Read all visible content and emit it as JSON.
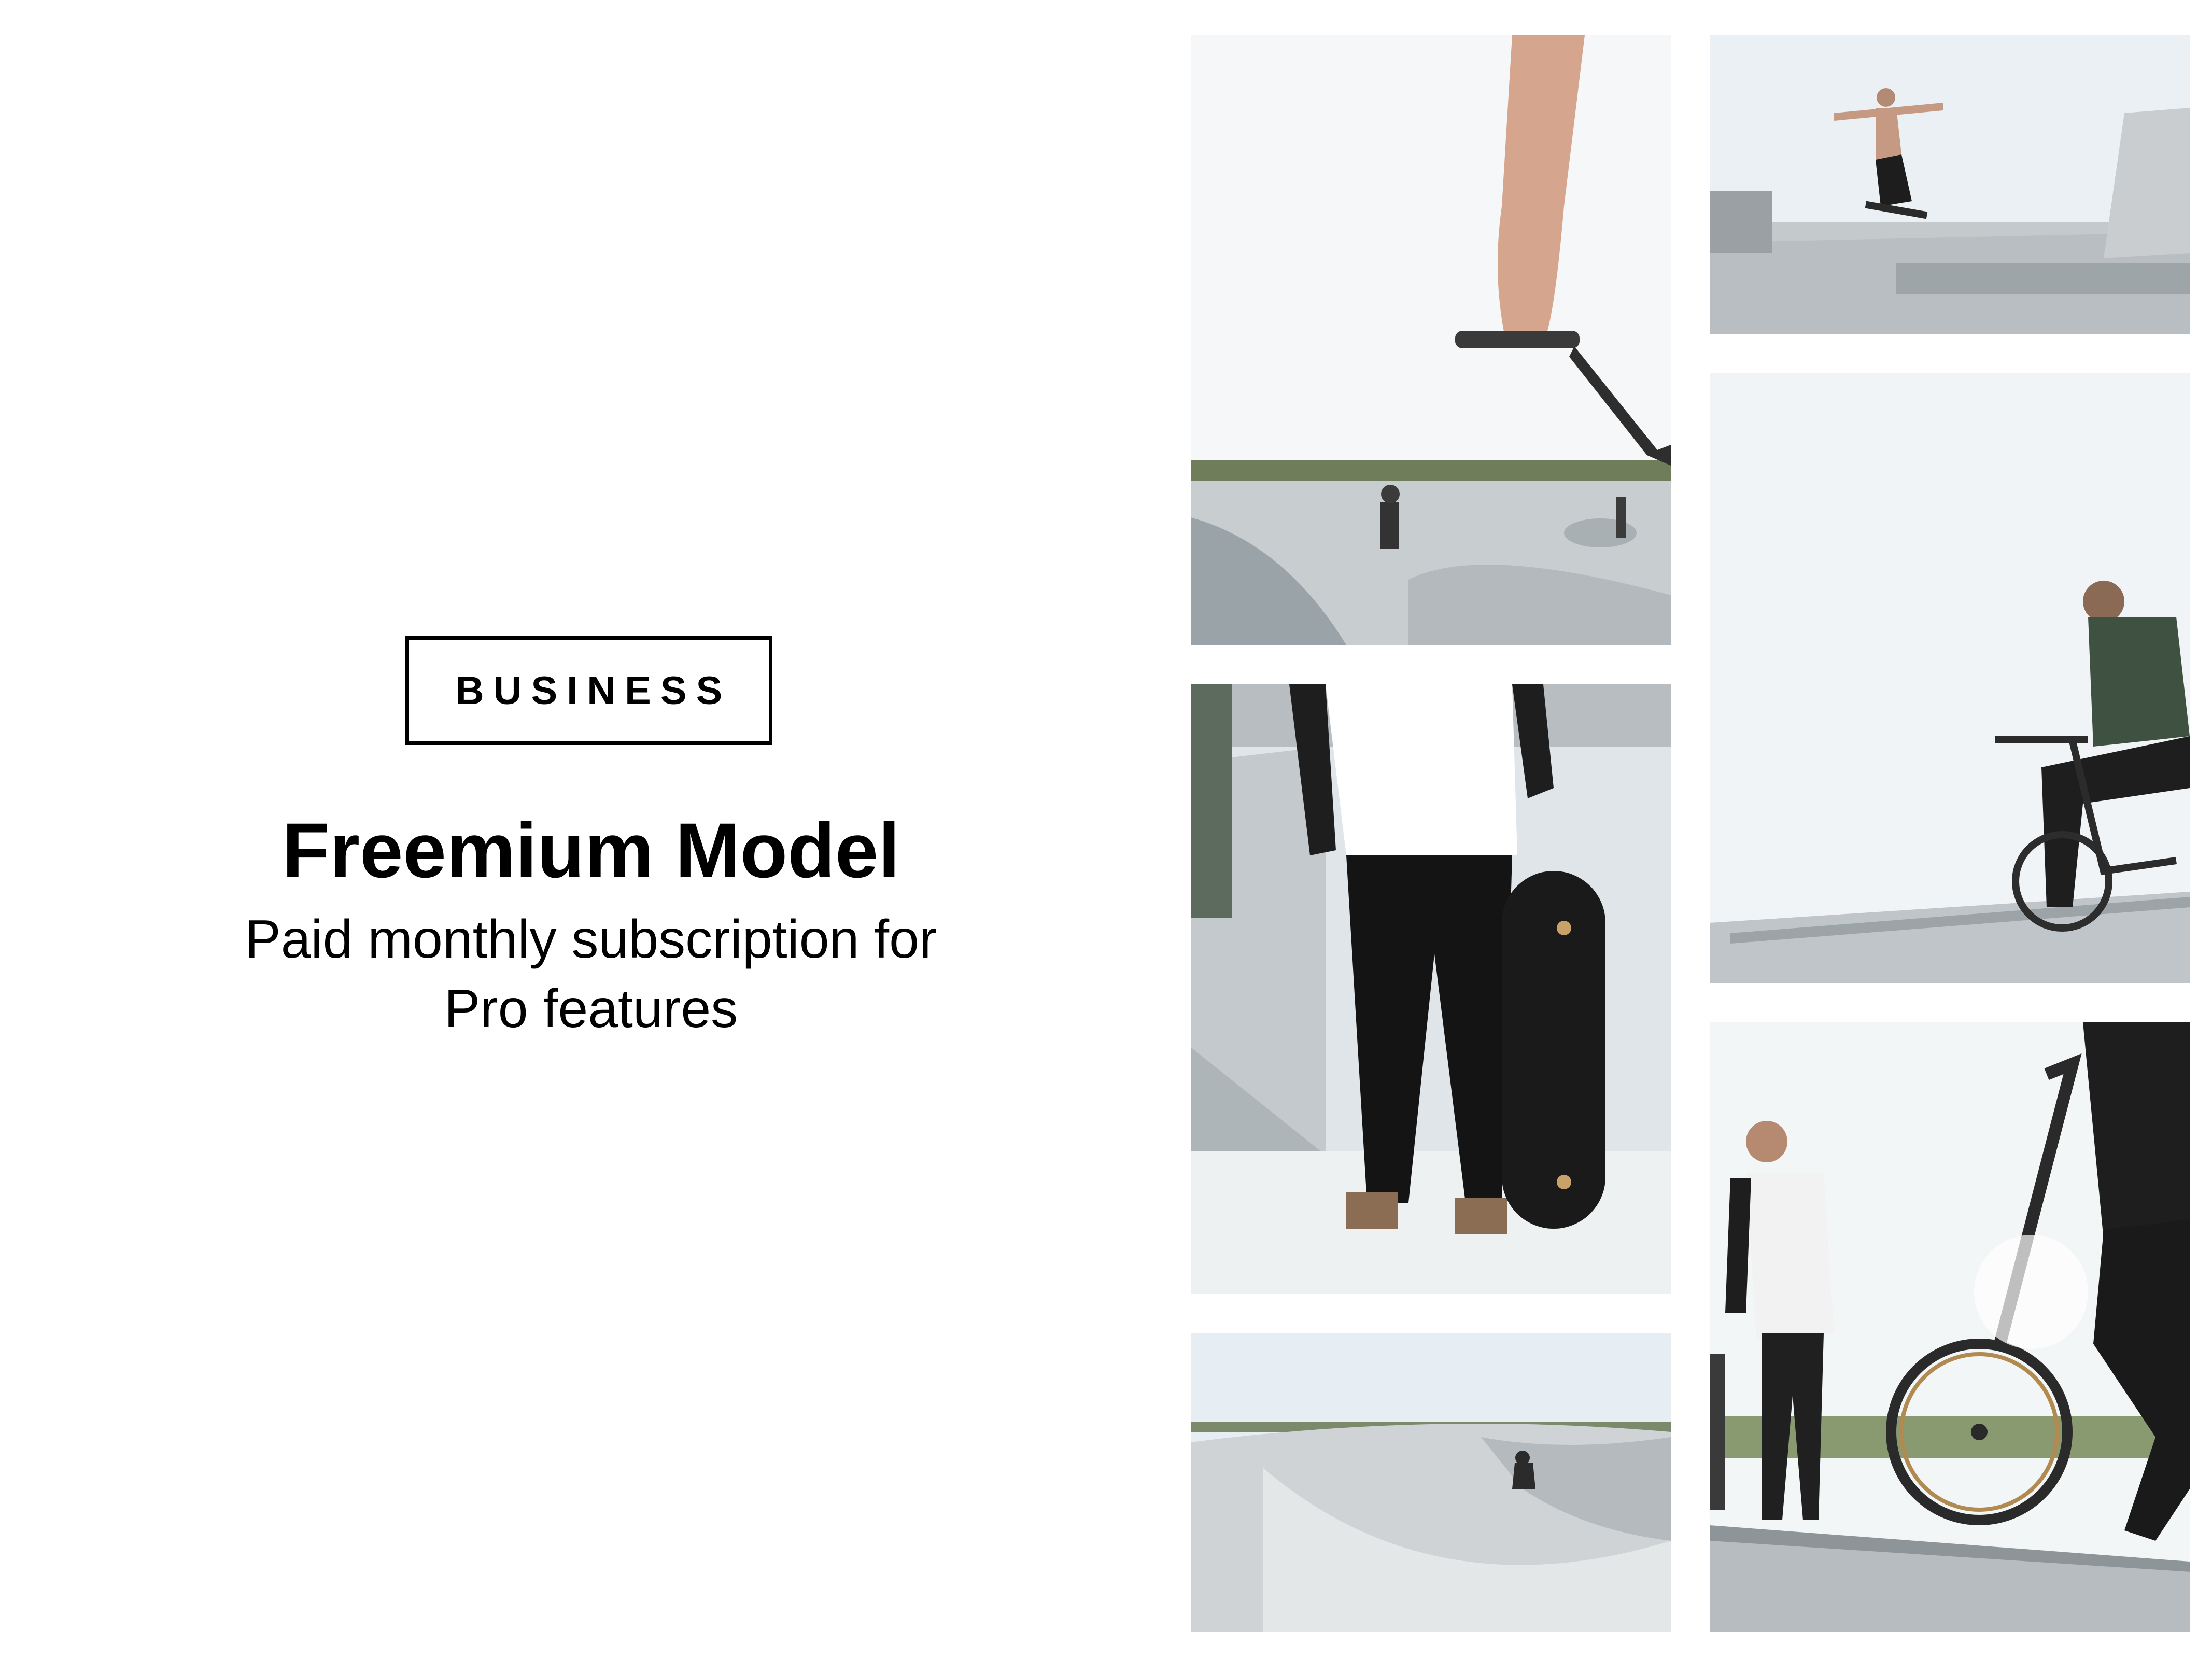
{
  "badge": {
    "label": "BUSINESS"
  },
  "headline": {
    "title": "Freemium Model",
    "subtitle_line1": "Paid monthly subscription for",
    "subtitle_line2": "Pro features"
  },
  "photos": [
    {
      "subject": "bmx-handlebar-skatepark"
    },
    {
      "subject": "skater-grinding-ledge"
    },
    {
      "subject": "bmx-rider-on-ledge"
    },
    {
      "subject": "skater-holding-skateboard"
    },
    {
      "subject": "skatepark-bowl"
    },
    {
      "subject": "skater-and-bmx-rider"
    }
  ],
  "colors": {
    "background": "#ffffff",
    "text": "#000000",
    "sky": "#f3f5f6",
    "concrete": "#c9ced1"
  }
}
